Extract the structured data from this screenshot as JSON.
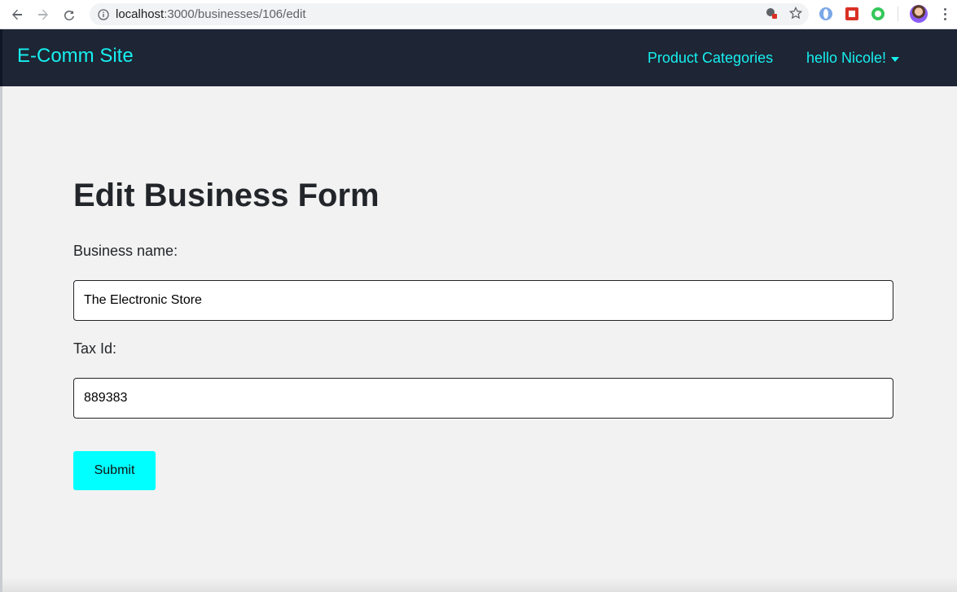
{
  "browser": {
    "url_host": "localhost",
    "url_path": ":3000/businesses/106/edit"
  },
  "navbar": {
    "brand": "E-Comm Site",
    "categories_link": "Product Categories",
    "user_menu": "hello Nicole!"
  },
  "form": {
    "title": "Edit Business Form",
    "business_name_label": "Business name:",
    "business_name_value": "The Electronic Store",
    "tax_id_label": "Tax Id:",
    "tax_id_value": "889383",
    "submit_label": "Submit"
  },
  "colors": {
    "navbar_bg": "#1e2534",
    "accent": "#16f0f0",
    "button": "#00ffff",
    "page_bg": "#f2f2f2"
  }
}
